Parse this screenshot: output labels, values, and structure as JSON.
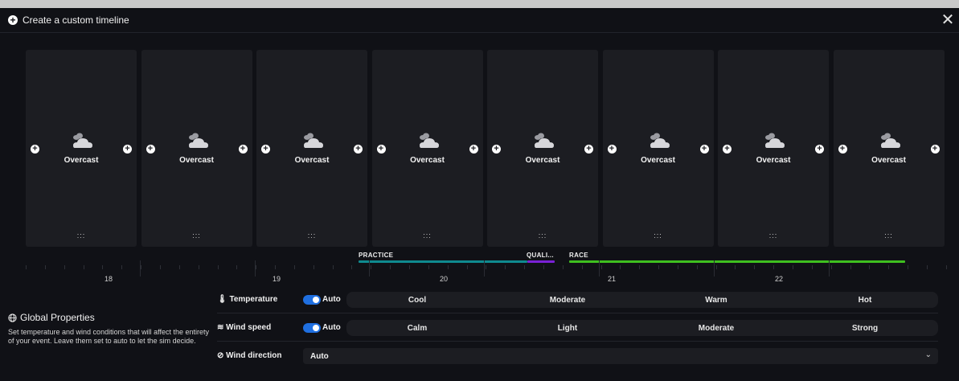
{
  "window": {
    "title": "Create a custom timeline",
    "close_icon": "close-icon"
  },
  "cards": [
    {
      "weather": "Overcast",
      "icon": "cloud-icon"
    },
    {
      "weather": "Overcast",
      "icon": "cloud-icon"
    },
    {
      "weather": "Overcast",
      "icon": "cloud-icon"
    },
    {
      "weather": "Overcast",
      "icon": "cloud-icon"
    },
    {
      "weather": "Overcast",
      "icon": "cloud-icon"
    },
    {
      "weather": "Overcast",
      "icon": "cloud-icon"
    },
    {
      "weather": "Overcast",
      "icon": "cloud-icon"
    },
    {
      "weather": "Overcast",
      "icon": "cloud-icon"
    }
  ],
  "drag_handle": ":::",
  "sessions": [
    {
      "label": "PRACTICE",
      "color": "#0f8a8f"
    },
    {
      "label": "QUALI...",
      "color": "#7a21d6"
    },
    {
      "label": "RACE",
      "color": "#3fbf1f"
    }
  ],
  "days": [
    "18",
    "19",
    "20",
    "21",
    "22"
  ],
  "global_properties": {
    "title": "Global Properties",
    "description": "Set temperature and wind conditions that will affect the entirety of your event. Leave them set to auto to let the sim decide.",
    "temperature": {
      "label": "Temperature",
      "auto_label": "Auto",
      "auto_on": true,
      "options": [
        "Cool",
        "Moderate",
        "Warm",
        "Hot"
      ]
    },
    "wind_speed": {
      "label": "Wind speed",
      "auto_label": "Auto",
      "auto_on": true,
      "options": [
        "Calm",
        "Light",
        "Moderate",
        "Strong"
      ]
    },
    "wind_direction": {
      "label": "Wind direction",
      "value": "Auto"
    }
  },
  "accent_color": "#1f6fe0"
}
